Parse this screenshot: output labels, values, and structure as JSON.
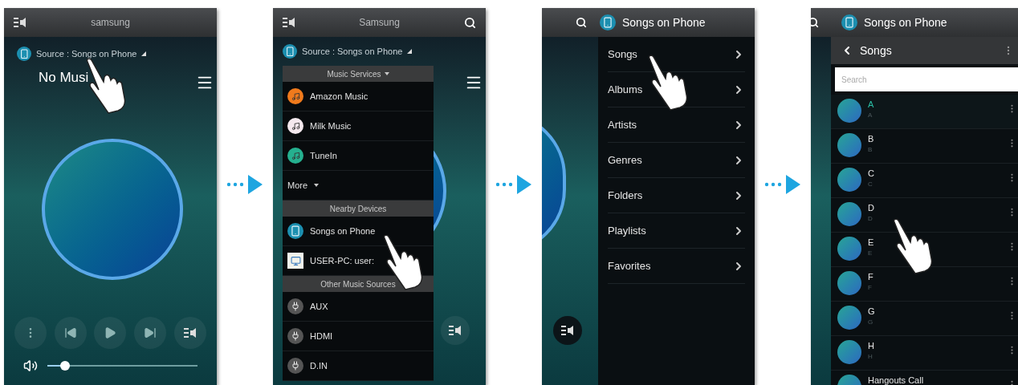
{
  "screens": [
    {
      "kind": "player",
      "header": {
        "title": "samsung"
      },
      "source": "Source : Songs on Phone",
      "now_playing": "No Musi",
      "volume": {
        "level": 0.12
      }
    },
    {
      "kind": "source_menu",
      "header": {
        "title": "Samsung"
      },
      "source": "Source : Songs on Phone",
      "sections": [
        {
          "title": "Music Services",
          "dropdown": true,
          "items": [
            {
              "label": "Amazon Music",
              "kind": "app",
              "color": "#f07a1c"
            },
            {
              "label": "Milk Music",
              "kind": "app",
              "color": "#f4e9ee"
            },
            {
              "label": "TuneIn",
              "kind": "app",
              "color": "#25b08f"
            },
            {
              "label": "More",
              "kind": "more"
            }
          ]
        },
        {
          "title": "Nearby Devices",
          "dropdown": false,
          "items": [
            {
              "label": "Songs on Phone",
              "kind": "phone"
            },
            {
              "label": "USER-PC: user:",
              "kind": "pc"
            }
          ]
        },
        {
          "title": "Other Music Sources",
          "dropdown": false,
          "items": [
            {
              "label": "AUX",
              "kind": "input"
            },
            {
              "label": "HDMI",
              "kind": "input"
            },
            {
              "label": "D.IN",
              "kind": "input"
            }
          ]
        }
      ]
    },
    {
      "kind": "library_menu",
      "header": {
        "title": "Songs on Phone"
      },
      "items": [
        "Songs",
        "Albums",
        "Artists",
        "Genres",
        "Folders",
        "Playlists",
        "Favorites"
      ]
    },
    {
      "kind": "song_list",
      "header": {
        "title": "Songs on Phone"
      },
      "title": "Songs",
      "search": {
        "placeholder": "Search"
      },
      "songs": [
        {
          "title": "A",
          "subtitle": "A",
          "selected": true
        },
        {
          "title": "B",
          "subtitle": "B",
          "selected": false
        },
        {
          "title": "C",
          "subtitle": "C",
          "selected": false
        },
        {
          "title": "D",
          "subtitle": "D",
          "selected": false
        },
        {
          "title": "E",
          "subtitle": "E",
          "selected": false
        },
        {
          "title": "F",
          "subtitle": "F",
          "selected": false
        },
        {
          "title": "G",
          "subtitle": "G",
          "selected": false
        },
        {
          "title": "H",
          "subtitle": "H",
          "selected": false
        },
        {
          "title": "Hangouts Call",
          "selected": false
        }
      ]
    }
  ]
}
